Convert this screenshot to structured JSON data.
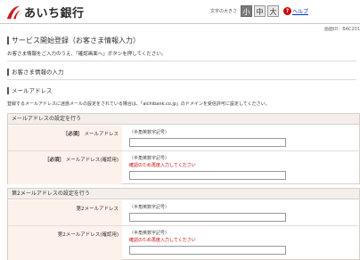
{
  "header": {
    "bank_name": "あいち銀行",
    "font_size_label": "文字の大きさ",
    "font_sizes": [
      "小",
      "中",
      "大"
    ],
    "help_label": "ヘルプ",
    "help_icon_text": "?"
  },
  "screen_id": "画面ID：BAC201",
  "page": {
    "title": "サービス開始登録（お客さま情報入力）",
    "description": "お客さま情報をご入力のうえ、「確認画面へ」ボタンを押してください。"
  },
  "customer_section": {
    "title": "お客さま情報の入力"
  },
  "email_section": {
    "title": "メールアドレス",
    "description": "登録するメールアドレスに迷惑メールの設定をされている場合は、「aichibank.co.jp」のドメインを受信許可に設定してください。"
  },
  "email_panel": {
    "title": "メールアドレスの設定を行う",
    "rows": [
      {
        "required": "［必須］",
        "label": "メールアドレス",
        "hint": "（半角英数字記号）",
        "warning": ""
      },
      {
        "required": "［必須］",
        "label": "メールアドレス(確認用)",
        "hint": "（半角英数字記号）",
        "warning": "確認のため再度入力してください"
      }
    ]
  },
  "email2_panel": {
    "title": "第2メールアドレスの設定を行う",
    "rows": [
      {
        "required": "",
        "label": "第2メールアドレス",
        "hint": "（半角英数字記号）",
        "warning": ""
      },
      {
        "required": "",
        "label": "第2メールアドレス(確認用)",
        "hint": "（半角英数字記号）",
        "warning": "確認のため再度入力してください"
      }
    ]
  },
  "colors": {
    "accent": "#cc0000",
    "label_bg": "#fdf1eb",
    "panel_title_bg": "#f3eeea"
  }
}
